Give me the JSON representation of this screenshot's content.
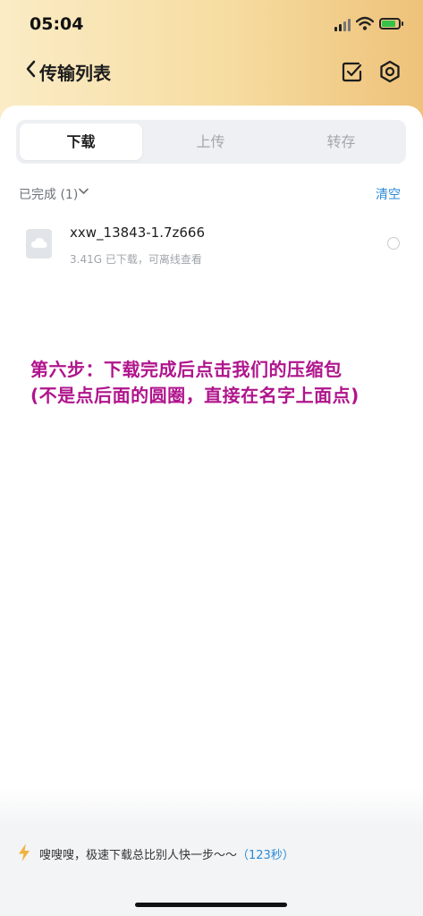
{
  "status_bar": {
    "time": "05:04"
  },
  "nav": {
    "title": "传输列表"
  },
  "tabs": [
    {
      "label": "下载",
      "active": true
    },
    {
      "label": "上传",
      "active": false
    },
    {
      "label": "转存",
      "active": false
    }
  ],
  "section": {
    "label": "已完成 (1)",
    "clear": "清空"
  },
  "files": [
    {
      "name": "xxw_13843-1.7z666",
      "meta": "3.41G  已下载，可离线查看"
    }
  ],
  "annotation": {
    "line1": "第六步：下载完成后点击我们的压缩包",
    "line2": "(不是点后面的圆圈，直接在名字上面点)"
  },
  "footer": {
    "tip": "嗖嗖嗖，极速下载总比别人快一步～～",
    "time": "（123秒）"
  },
  "colors": {
    "accent": "#2a8ad8",
    "annotation": "#b0148c"
  }
}
